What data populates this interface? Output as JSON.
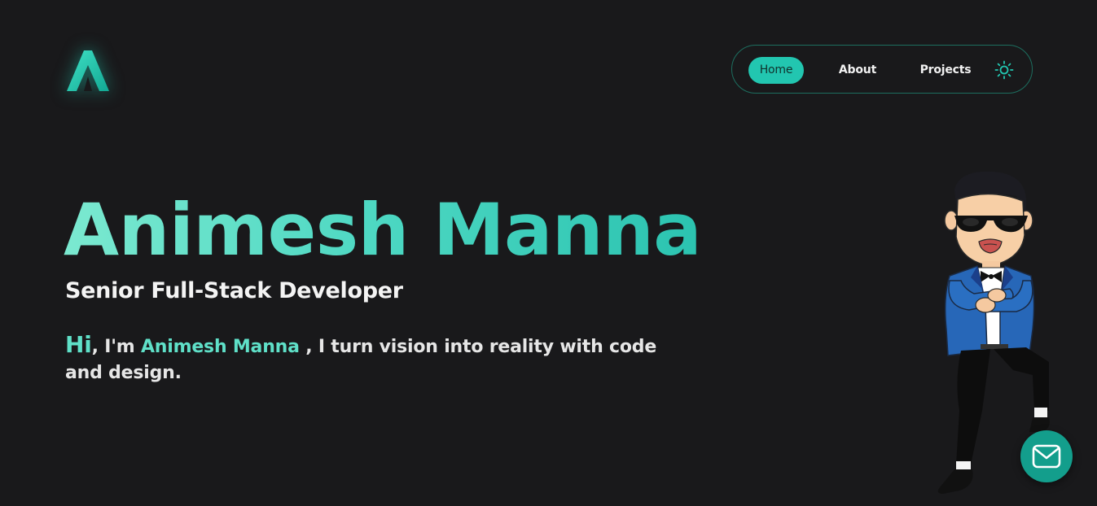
{
  "brand": {
    "logo_icon": "a-logo-icon",
    "accent": "#22c6b0"
  },
  "nav": {
    "items": [
      {
        "label": "Home",
        "active": true
      },
      {
        "label": "About",
        "active": false
      },
      {
        "label": "Projects",
        "active": false
      }
    ],
    "theme_toggle_icon": "sun-icon"
  },
  "hero": {
    "name": "Animesh Manna",
    "role": "Senior Full-Stack Developer",
    "intro": {
      "greeting": "Hi",
      "prefix": ", I'm ",
      "name": "Animesh Manna",
      "suffix": " , I turn vision into reality with code and design."
    }
  },
  "illustration": {
    "icon": "dancing-character-illustration"
  },
  "contact": {
    "icon": "mail-icon",
    "color": "#139e8c"
  }
}
